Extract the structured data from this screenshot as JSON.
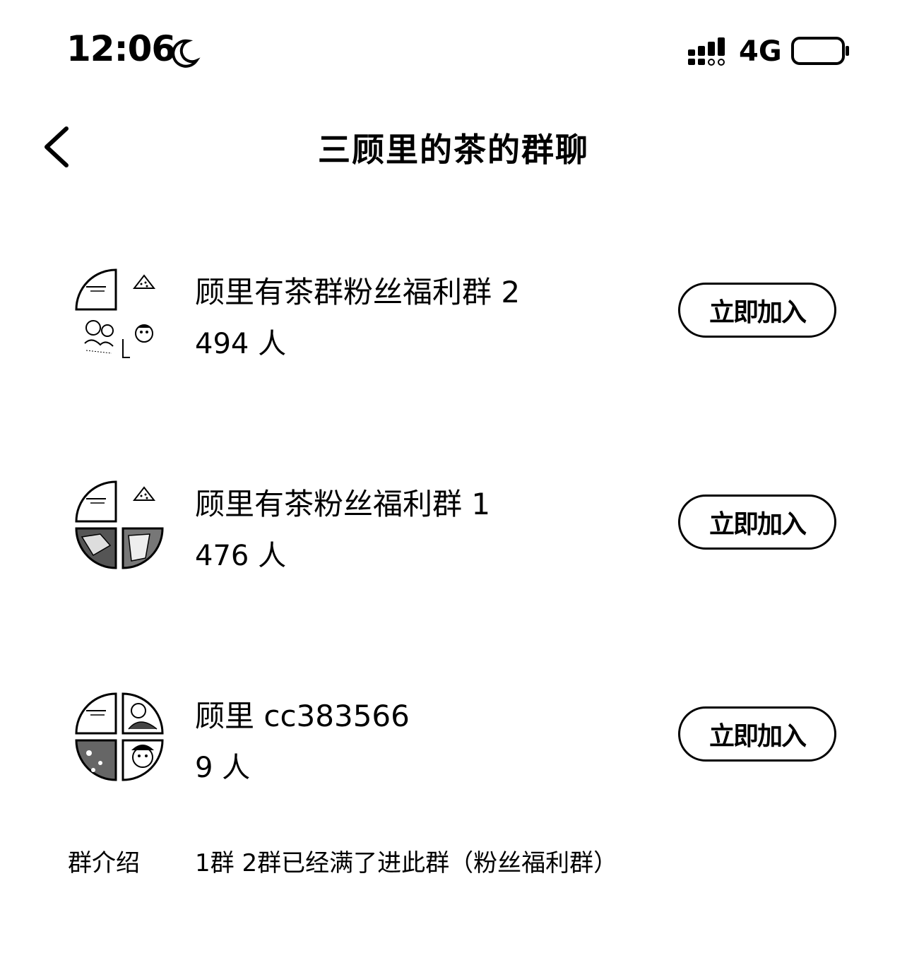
{
  "status_bar": {
    "time": "12:06",
    "network": "4G",
    "moon_icon": "moon-icon",
    "signal_icon": "signal-icon",
    "battery_icon": "battery-icon"
  },
  "nav": {
    "back_icon": "chevron-left-icon",
    "title": "三顾里的茶的群聊"
  },
  "groups": [
    {
      "name": "顾里有茶群粉丝福利群 2",
      "count": "494 人",
      "join_label": "立即加入"
    },
    {
      "name": "顾里有茶粉丝福利群 1",
      "count": "476 人",
      "join_label": "立即加入"
    },
    {
      "name": "顾里 cc383566",
      "count": "9 人",
      "join_label": "立即加入"
    }
  ],
  "intro": {
    "label": "群介绍",
    "text": "1群 2群已经满了进此群（粉丝福利群）"
  }
}
